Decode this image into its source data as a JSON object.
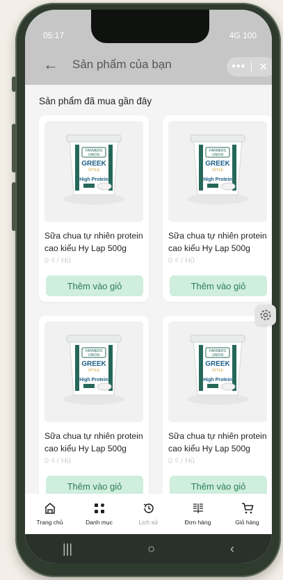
{
  "status_bar": {
    "time": "05:17",
    "indicators": "4G 100"
  },
  "header": {
    "back_icon": "back-arrow-icon",
    "title": "Sản phẩm của bạn",
    "more_icon": "more-dots-icon",
    "close_icon": "close-icon"
  },
  "section": {
    "title": "Sản phẩm đã mua gần đây"
  },
  "products": [
    {
      "name": "Sữa chua tự nhiên protein cao kiểu Hy Lạp 500g",
      "price": "0 ₫ / Hủ",
      "button": "Thêm vào giỏ",
      "image_text": {
        "brand1": "FARMERS",
        "brand2": "UNION",
        "title": "GREEK",
        "style": "STYLE",
        "hp": "High Protein"
      }
    },
    {
      "name": "Sữa chua tự nhiên protein cao kiểu Hy Lạp 500g",
      "price": "0 ₫ / Hủ",
      "button": "Thêm vào giỏ",
      "image_text": {
        "brand1": "FARMERS",
        "brand2": "UNION",
        "title": "GREEK",
        "style": "STYLE",
        "hp": "High Protein"
      }
    },
    {
      "name": "Sữa chua tự nhiên protein cao kiểu Hy Lạp 500g",
      "price": "0 ₫ / Hủ",
      "button": "Thêm vào giỏ",
      "image_text": {
        "brand1": "FARMERS",
        "brand2": "UNION",
        "title": "GREEK",
        "style": "STYLE",
        "hp": "High Protein"
      }
    },
    {
      "name": "Sữa chua tự nhiên protein cao kiểu Hy Lạp 500g",
      "price": "0 ₫ / Hủ",
      "button": "Thêm vào giỏ",
      "image_text": {
        "brand1": "FARMERS",
        "brand2": "UNION",
        "title": "GREEK",
        "style": "STYLE",
        "hp": "High Protein"
      }
    }
  ],
  "tabs": [
    {
      "label": "Trang chủ",
      "icon": "home-store-icon",
      "active": true
    },
    {
      "label": "Danh mục",
      "icon": "grid-icon",
      "active": true
    },
    {
      "label": "Lịch sử",
      "icon": "history-icon",
      "active": false
    },
    {
      "label": "Đơn hàng",
      "icon": "orders-icon",
      "active": true
    },
    {
      "label": "Giỏ hàng",
      "icon": "cart-icon",
      "active": true
    }
  ],
  "system_nav": {
    "recent": "|||",
    "home": "○",
    "back": "‹"
  },
  "colors": {
    "accent_green": "#2d7e55",
    "button_bg": "#cfeedd",
    "header_gray": "#c6c6c6",
    "frame": "#2f3b2f"
  }
}
